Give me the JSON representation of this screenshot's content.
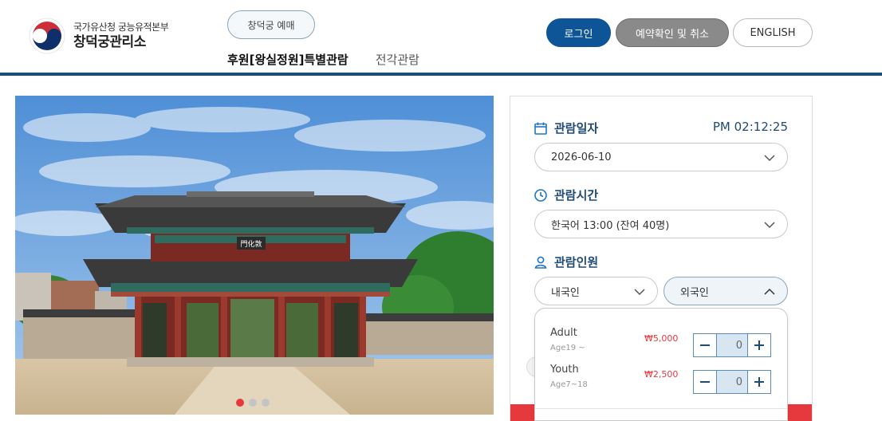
{
  "header": {
    "logo_sub": "국가유산청 궁능유적본부",
    "logo_main": "창덕궁관리소",
    "site_pill": "창덕궁 예매",
    "nav": [
      {
        "label": "후원[왕실정원]특별관람",
        "active": true
      },
      {
        "label": "전각관람",
        "active": false
      }
    ],
    "login": "로그인",
    "reserve_check": "예약확인 및 취소",
    "english": "ENGLISH"
  },
  "slideshow": {
    "gate_sign": "門化敦",
    "dots": [
      true,
      false,
      false
    ]
  },
  "booking": {
    "date_title": "관람일자",
    "clock": "PM 02:12:25",
    "date_value": "2026-06-10",
    "time_title": "관람시간",
    "time_value": "한국어 13:00 (잔여 40명)",
    "people_title": "관람인원",
    "domestic": "내국인",
    "foreign": "외국인",
    "tickets": [
      {
        "label": "Adult",
        "age": "Age19 ~",
        "price": "₩5,000",
        "count": "0"
      },
      {
        "label": "Youth",
        "age": "Age7~18",
        "price": "₩2,500",
        "count": "0"
      }
    ]
  },
  "colors": {
    "primary": "#0d5596",
    "accent": "#e6393d",
    "title": "#1f4a73",
    "header_line": "#1a4e7a"
  },
  "icons": {
    "date": "calendar-icon",
    "time": "clock-icon",
    "people": "person-icon",
    "dropdown": "chevron-down-icon",
    "minus": "minus-icon",
    "plus": "plus-icon"
  }
}
